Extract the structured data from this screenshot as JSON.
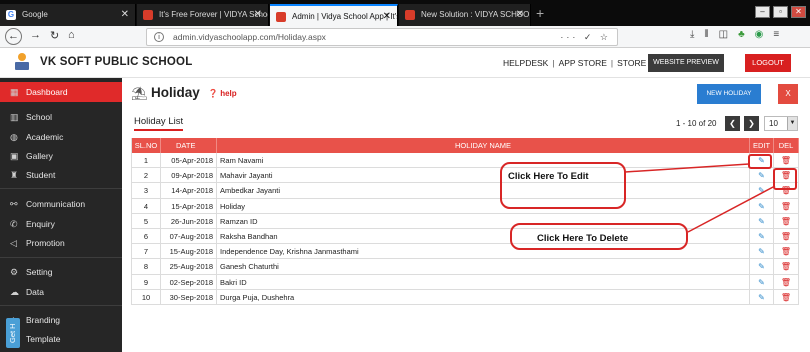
{
  "browser": {
    "tabs": [
      {
        "label": "Google",
        "color": "#4285f4"
      },
      {
        "label": "It's Free Forever | VIDYA School",
        "color": "#d83c2a"
      },
      {
        "label": "Admin | Vidya School App | It's",
        "color": "#d83c2a",
        "active": true
      },
      {
        "label": "New Solution : VIDYA SCHOOL",
        "color": "#d83c2a"
      }
    ],
    "url_host": "admin.vidyaschoolapp.com",
    "url_path": "/Holiday.aspx",
    "url_actions": "··· ✓ ☆"
  },
  "header": {
    "school_name": "VK SOFT PUBLIC SCHOOL",
    "links": [
      "HELPDESK",
      "APP STORE",
      "STORE"
    ],
    "preview_label": "WEBSITE PREVIEW",
    "logout_label": "LOGOUT"
  },
  "sidebar": {
    "items": [
      {
        "label": "Dashboard",
        "icon": "dashboard-icon",
        "glyph": "▦"
      },
      {
        "label": "School",
        "icon": "school-icon",
        "glyph": "▥"
      },
      {
        "label": "Academic",
        "icon": "globe-icon",
        "glyph": "◍"
      },
      {
        "label": "Gallery",
        "icon": "image-icon",
        "glyph": "▣"
      },
      {
        "label": "Student",
        "icon": "student-icon",
        "glyph": "♜"
      },
      {
        "label": "Communication",
        "icon": "link-icon",
        "glyph": "⚯"
      },
      {
        "label": "Enquiry",
        "icon": "phone-icon",
        "glyph": "✆"
      },
      {
        "label": "Promotion",
        "icon": "megaphone-icon",
        "glyph": "◁"
      },
      {
        "label": "Setting",
        "icon": "gear-icon",
        "glyph": "⚙"
      },
      {
        "label": "Data",
        "icon": "cloud-icon",
        "glyph": "☁"
      },
      {
        "label": "Branding",
        "icon": "tag-icon",
        "glyph": "◆"
      },
      {
        "label": "Template",
        "icon": "template-icon",
        "glyph": "▤"
      }
    ],
    "get_help": "Get H"
  },
  "page": {
    "title": "Holiday",
    "help": "help",
    "new_button": "NEW HOLIDAY",
    "close_button": "X",
    "list_tab": "Holiday List",
    "pagination_text": "1 - 10 of 20",
    "page_size": "10"
  },
  "table": {
    "headers": {
      "no": "SL.NO",
      "date": "DATE",
      "name": "HOLIDAY NAME",
      "edit": "EDIT",
      "del": "DEL"
    },
    "rows": [
      {
        "no": "1",
        "date": "05-Apr-2018",
        "name": "Ram Navami"
      },
      {
        "no": "2",
        "date": "09-Apr-2018",
        "name": "Mahavir Jayanti"
      },
      {
        "no": "3",
        "date": "14-Apr-2018",
        "name": "Ambedkar Jayanti"
      },
      {
        "no": "4",
        "date": "15-Apr-2018",
        "name": "Holiday"
      },
      {
        "no": "5",
        "date": "26-Jun-2018",
        "name": "Ramzan ID"
      },
      {
        "no": "6",
        "date": "07-Aug-2018",
        "name": "Raksha Bandhan"
      },
      {
        "no": "7",
        "date": "15-Aug-2018",
        "name": "Independence Day, Krishna Janmasthami"
      },
      {
        "no": "8",
        "date": "25-Aug-2018",
        "name": "Ganesh Chaturthi"
      },
      {
        "no": "9",
        "date": "02-Sep-2018",
        "name": "Bakri ID"
      },
      {
        "no": "10",
        "date": "30-Sep-2018",
        "name": "Durga Puja, Dushehra"
      }
    ]
  },
  "annotations": {
    "edit": "Click Here To Edit",
    "delete": "Click Here To Delete"
  }
}
